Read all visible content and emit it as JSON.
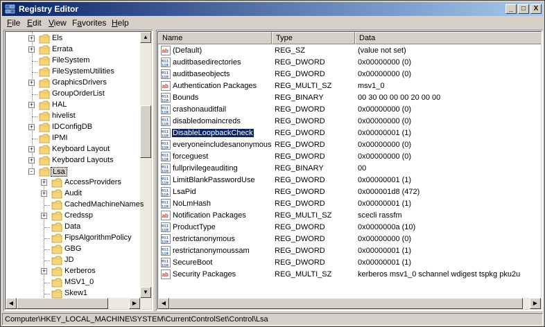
{
  "window": {
    "title": "Registry Editor",
    "minimize_glyph": "_",
    "maximize_glyph": "□",
    "close_glyph": "X"
  },
  "menu": [
    {
      "label": "File",
      "accel": "F",
      "rest": "ile"
    },
    {
      "label": "Edit",
      "accel": "E",
      "rest": "dit"
    },
    {
      "label": "View",
      "accel": "V",
      "rest": "iew"
    },
    {
      "label": "Favorites",
      "accel": "F",
      "rest": "avorites",
      "prefix": "F"
    },
    {
      "label": "Help",
      "accel": "H",
      "rest": "elp"
    }
  ],
  "tree": {
    "items": [
      {
        "label": "Els",
        "expander": "+"
      },
      {
        "label": "Errata",
        "expander": "+"
      },
      {
        "label": "FileSystem",
        "expander": ""
      },
      {
        "label": "FileSystemUtilities",
        "expander": ""
      },
      {
        "label": "GraphicsDrivers",
        "expander": "+"
      },
      {
        "label": "GroupOrderList",
        "expander": ""
      },
      {
        "label": "HAL",
        "expander": "+"
      },
      {
        "label": "hivelist",
        "expander": ""
      },
      {
        "label": "IDConfigDB",
        "expander": "+"
      },
      {
        "label": "IPMI",
        "expander": ""
      },
      {
        "label": "Keyboard Layout",
        "expander": "+"
      },
      {
        "label": "Keyboard Layouts",
        "expander": "+"
      },
      {
        "label": "Lsa",
        "expander": "-",
        "selected": true
      }
    ],
    "children": [
      {
        "label": "AccessProviders",
        "expander": "+"
      },
      {
        "label": "Audit",
        "expander": "+"
      },
      {
        "label": "CachedMachineNames",
        "expander": ""
      },
      {
        "label": "Credssp",
        "expander": "+"
      },
      {
        "label": "Data",
        "expander": ""
      },
      {
        "label": "FipsAlgorithmPolicy",
        "expander": ""
      },
      {
        "label": "GBG",
        "expander": ""
      },
      {
        "label": "JD",
        "expander": ""
      },
      {
        "label": "Kerberos",
        "expander": "+"
      },
      {
        "label": "MSV1_0",
        "expander": ""
      },
      {
        "label": "Skew1",
        "expander": ""
      }
    ]
  },
  "list": {
    "columns": [
      "Name",
      "Type",
      "Data"
    ],
    "rows": [
      {
        "name": "(Default)",
        "type": "REG_SZ",
        "data": "(value not set)",
        "icon": "ab"
      },
      {
        "name": "auditbasedirectories",
        "type": "REG_DWORD",
        "data": "0x00000000 (0)",
        "icon": "bin"
      },
      {
        "name": "auditbaseobjects",
        "type": "REG_DWORD",
        "data": "0x00000000 (0)",
        "icon": "bin"
      },
      {
        "name": "Authentication Packages",
        "type": "REG_MULTI_SZ",
        "data": "msv1_0",
        "icon": "ab"
      },
      {
        "name": "Bounds",
        "type": "REG_BINARY",
        "data": "00 30 00 00 00 20 00 00",
        "icon": "bin"
      },
      {
        "name": "crashonauditfail",
        "type": "REG_DWORD",
        "data": "0x00000000 (0)",
        "icon": "bin"
      },
      {
        "name": "disabledomaincreds",
        "type": "REG_DWORD",
        "data": "0x00000000 (0)",
        "icon": "bin"
      },
      {
        "name": "DisableLoopbackCheck",
        "type": "REG_DWORD",
        "data": "0x00000001 (1)",
        "icon": "bin",
        "selected": true
      },
      {
        "name": "everyoneincludesanonymous",
        "type": "REG_DWORD",
        "data": "0x00000000 (0)",
        "icon": "bin"
      },
      {
        "name": "forceguest",
        "type": "REG_DWORD",
        "data": "0x00000000 (0)",
        "icon": "bin"
      },
      {
        "name": "fullprivilegeauditing",
        "type": "REG_BINARY",
        "data": "00",
        "icon": "bin"
      },
      {
        "name": "LimitBlankPasswordUse",
        "type": "REG_DWORD",
        "data": "0x00000001 (1)",
        "icon": "bin"
      },
      {
        "name": "LsaPid",
        "type": "REG_DWORD",
        "data": "0x000001d8 (472)",
        "icon": "bin"
      },
      {
        "name": "NoLmHash",
        "type": "REG_DWORD",
        "data": "0x00000001 (1)",
        "icon": "bin"
      },
      {
        "name": "Notification Packages",
        "type": "REG_MULTI_SZ",
        "data": "scecli rassfm",
        "icon": "ab"
      },
      {
        "name": "ProductType",
        "type": "REG_DWORD",
        "data": "0x0000000a (10)",
        "icon": "bin"
      },
      {
        "name": "restrictanonymous",
        "type": "REG_DWORD",
        "data": "0x00000000 (0)",
        "icon": "bin"
      },
      {
        "name": "restrictanonymoussam",
        "type": "REG_DWORD",
        "data": "0x00000001 (1)",
        "icon": "bin"
      },
      {
        "name": "SecureBoot",
        "type": "REG_DWORD",
        "data": "0x00000001 (1)",
        "icon": "bin"
      },
      {
        "name": "Security Packages",
        "type": "REG_MULTI_SZ",
        "data": "kerberos msv1_0 schannel wdigest tspkg pku2u",
        "icon": "ab"
      }
    ]
  },
  "status": {
    "path": "Computer\\HKEY_LOCAL_MACHINE\\SYSTEM\\CurrentControlSet\\Control\\Lsa"
  },
  "colors": {
    "title_start": "#0a246a",
    "title_end": "#a6caf0",
    "selection": "#0a246a",
    "folder": "#e8c35a"
  }
}
